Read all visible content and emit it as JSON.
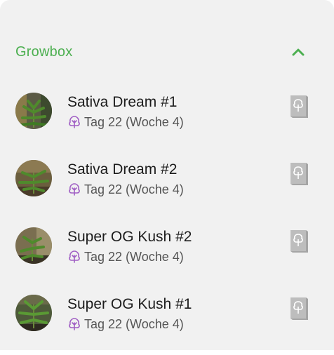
{
  "section": {
    "title": "Growbox",
    "collapse_icon": "chevron-up-icon",
    "accent_color": "#4caf50"
  },
  "plants": [
    {
      "name": "Sativa Dream #1",
      "status": "Tag 22 (Woche 4)"
    },
    {
      "name": "Sativa Dream #2",
      "status": "Tag 22 (Woche 4)"
    },
    {
      "name": "Super OG Kush #2",
      "status": "Tag 22 (Woche 4)"
    },
    {
      "name": "Super OG Kush #1",
      "status": "Tag 22 (Woche 4)"
    }
  ],
  "icons": {
    "status": "sprout-icon",
    "action": "diary-book-icon",
    "status_color": "#a05fc4",
    "action_color": "#bdbdbd"
  }
}
